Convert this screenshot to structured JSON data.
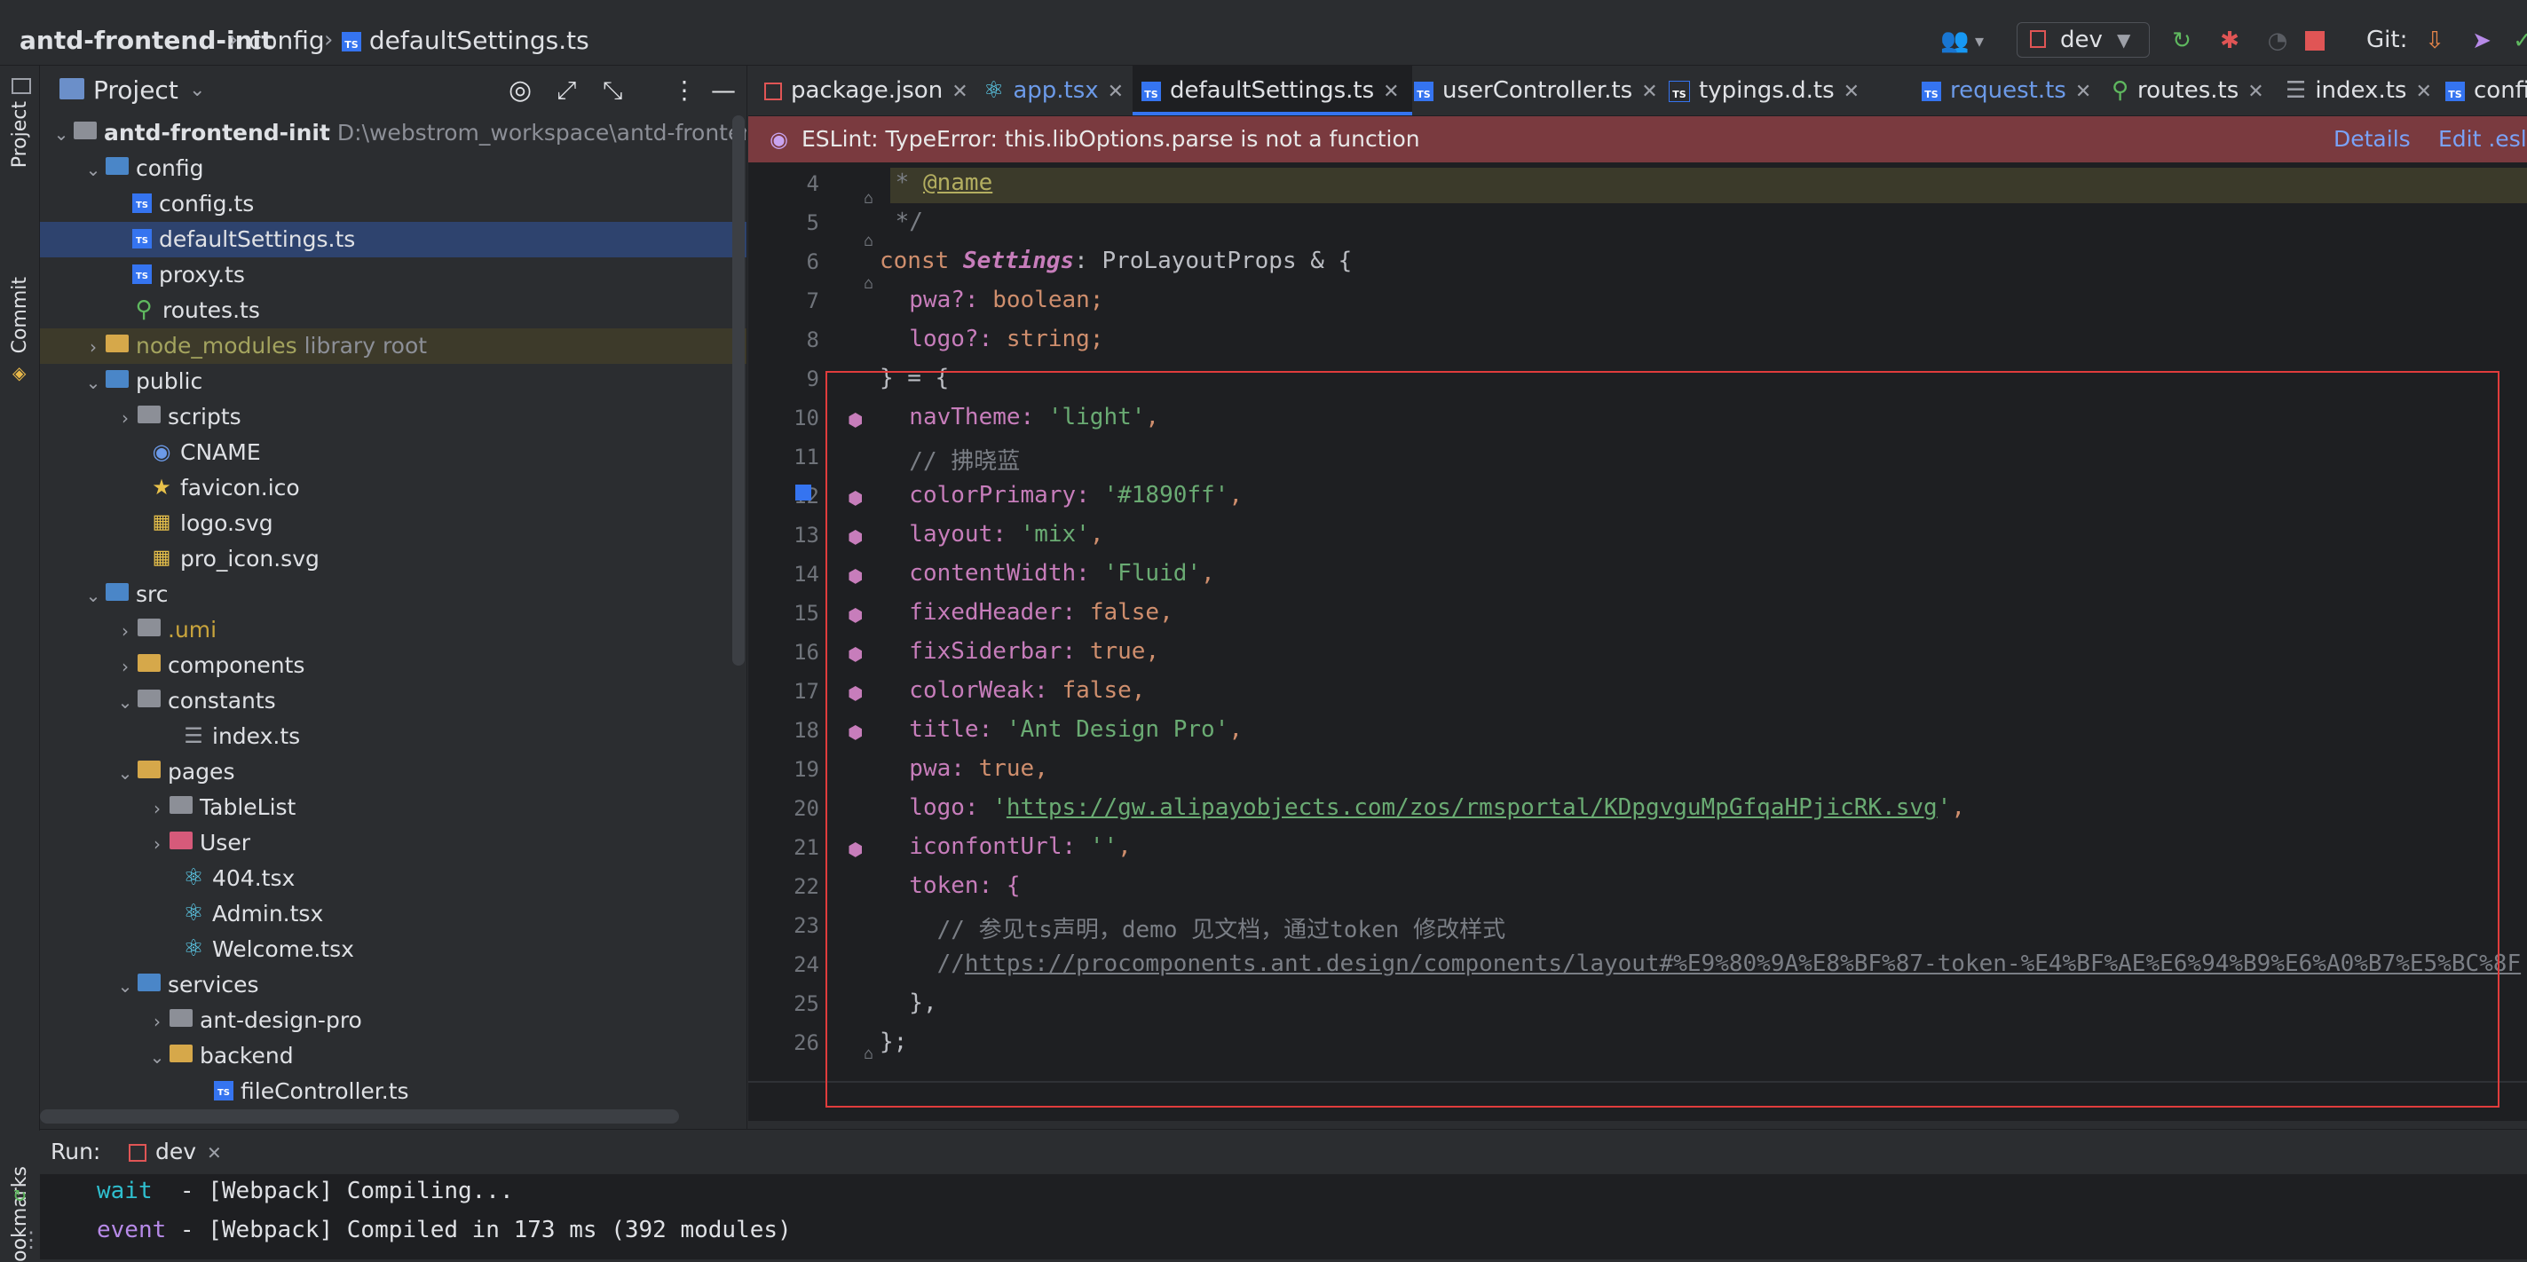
{
  "breadcrumb": {
    "project": "antd-frontend-init",
    "folder": "config",
    "file": "defaultSettings.ts"
  },
  "toolbar": {
    "run_config": "dev",
    "git_label": "Git:"
  },
  "side_tools": {
    "project": "Project",
    "commit": "Commit",
    "bookmarks": "ookmarks"
  },
  "project_panel": {
    "title": "Project",
    "rows": [
      {
        "label": "antd-frontend-init",
        "extra": "D:\\webstrom_workspace\\antd-frontend-ir"
      },
      {
        "label": "config"
      },
      {
        "label": "config.ts"
      },
      {
        "label": "defaultSettings.ts"
      },
      {
        "label": "proxy.ts"
      },
      {
        "label": "routes.ts"
      },
      {
        "label": "node_modules",
        "extra": "library root"
      },
      {
        "label": "public"
      },
      {
        "label": "scripts"
      },
      {
        "label": "CNAME"
      },
      {
        "label": "favicon.ico"
      },
      {
        "label": "logo.svg"
      },
      {
        "label": "pro_icon.svg"
      },
      {
        "label": "src"
      },
      {
        "label": ".umi"
      },
      {
        "label": "components"
      },
      {
        "label": "constants"
      },
      {
        "label": "index.ts"
      },
      {
        "label": "pages"
      },
      {
        "label": "TableList"
      },
      {
        "label": "User"
      },
      {
        "label": "404.tsx"
      },
      {
        "label": "Admin.tsx"
      },
      {
        "label": "Welcome.tsx"
      },
      {
        "label": "services"
      },
      {
        "label": "ant-design-pro"
      },
      {
        "label": "backend"
      },
      {
        "label": "fileController.ts"
      }
    ]
  },
  "tabs": [
    {
      "label": "package.json"
    },
    {
      "label": "app.tsx"
    },
    {
      "label": "defaultSettings.ts"
    },
    {
      "label": "userController.ts"
    },
    {
      "label": "typings.d.ts"
    },
    {
      "label": "request.ts"
    },
    {
      "label": "routes.ts"
    },
    {
      "label": "index.ts"
    },
    {
      "label": "config.ts"
    }
  ],
  "lint": {
    "message": "ESLint: TypeError: this.libOptions.parse is not a function",
    "details": "Details",
    "edit": "Edit .eslin"
  },
  "code": {
    "line_numbers": [
      "4",
      "5",
      "6",
      "7",
      "8",
      "9",
      "10",
      "11",
      "12",
      "13",
      "14",
      "15",
      "16",
      "17",
      "18",
      "19",
      "20",
      "21",
      "22",
      "23",
      "24",
      "25",
      "26"
    ],
    "l4_star": " * ",
    "l4_tag": "@name",
    "l5": " */",
    "l6_const": "const ",
    "l6_name": "Settings",
    "l6_rest": ": ProLayoutProps & {",
    "l7_key": "  pwa?: ",
    "l7_type": "boolean;",
    "l8_key": "  logo?: ",
    "l8_type": "string;",
    "l9": "} = {",
    "l10_key": "  navTheme: ",
    "l10_val": "'light'",
    "l10_end": ",",
    "l11": "  // 拂晓蓝",
    "l12_key": "  colorPrimary: ",
    "l12_val": "'#1890ff'",
    "l12_end": ",",
    "l13_key": "  layout: ",
    "l13_val": "'mix'",
    "l13_end": ",",
    "l14_key": "  contentWidth: ",
    "l14_val": "'Fluid'",
    "l14_end": ",",
    "l15_key": "  fixedHeader: ",
    "l15_val": "false",
    "l15_end": ",",
    "l16_key": "  fixSiderbar: ",
    "l16_val": "true",
    "l16_end": ",",
    "l17_key": "  colorWeak: ",
    "l17_val": "false",
    "l17_end": ",",
    "l18_key": "  title: ",
    "l18_val": "'Ant Design Pro'",
    "l18_end": ",",
    "l19_key": "  pwa: ",
    "l19_val": "true",
    "l19_end": ",",
    "l20_key": "  logo: ",
    "l20_q1": "'",
    "l20_url": "https://gw.alipayobjects.com/zos/rmsportal/KDpgvguMpGfqaHPjicRK.svg",
    "l20_q2": "'",
    "l20_end": ",",
    "l21_key": "  iconfontUrl: ",
    "l21_val": "''",
    "l21_end": ",",
    "l22": "  token: {",
    "l23": "    // 参见ts声明，demo 见文档，通过token 修改样式",
    "l24_pre": "    //",
    "l24_url": "https://procomponents.ant.design/components/layout#%E9%80%9A%E8%BF%87-token-%E4%BF%AE%E6%94%B9%E6%A0%B7%E5%BC%8F",
    "l25": "  },",
    "l26": "};"
  },
  "run_panel": {
    "label": "Run:",
    "tab": "dev",
    "line1_tag": "wait",
    "line1_text": "  - [Webpack] Compiling...",
    "line2_tag": "event",
    "line2_text": " - [Webpack] Compiled in 173 ms (392 modules)"
  }
}
